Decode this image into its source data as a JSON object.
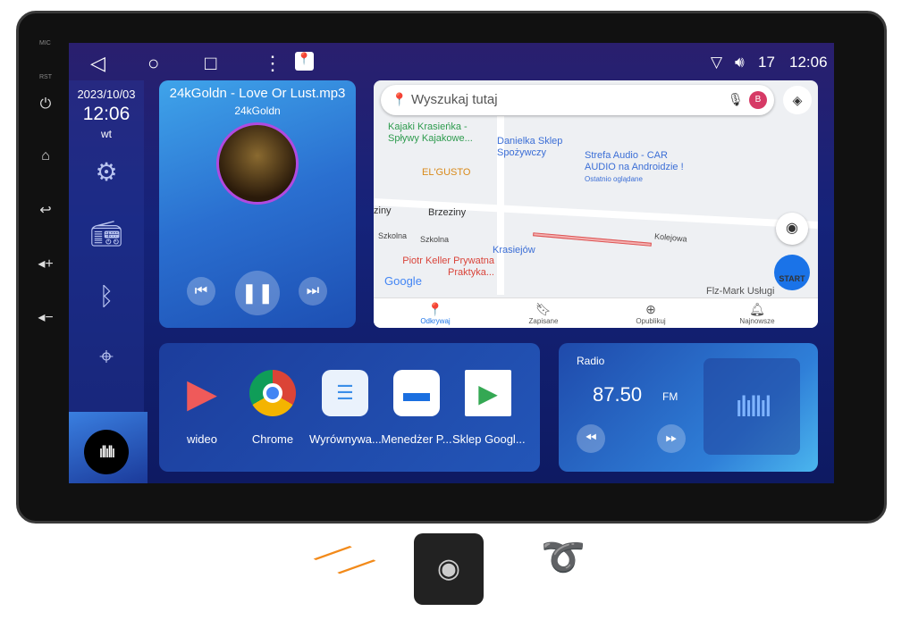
{
  "bezel": {
    "labels": [
      "MIC",
      "RST"
    ],
    "buttons": [
      "power-icon",
      "home-icon",
      "back-icon",
      "volume-up-icon",
      "volume-down-icon"
    ]
  },
  "nav": {
    "icons": [
      "back-icon",
      "home-icon",
      "recents-icon",
      "more-icon",
      "maps-icon"
    ]
  },
  "status": {
    "volume": "17",
    "time": "12:06"
  },
  "clock": {
    "date": "2023/10/03",
    "time": "12:06",
    "day": "wt"
  },
  "sidebar": {
    "icons": [
      "settings-icon",
      "radio-icon",
      "bluetooth-icon",
      "location-icon",
      "voice-icon"
    ]
  },
  "music": {
    "title": "24kGoldn - Love Or Lust.mp3",
    "artist": "24kGoldn"
  },
  "map": {
    "search_placeholder": "Wyszukaj tutaj",
    "avatar": "B",
    "pois": {
      "kajaki": "Kajaki Krasieńka - Spływy Kajakowe...",
      "danielka": "Danielka Sklep Spożywczy",
      "strefa": "Strefa Audio - CAR AUDIO na Androidzie !",
      "strefa_sub": "Ostatnio oglądane",
      "elgusto": "EL'GUSTO",
      "brzeziny": "Brzeziny",
      "brzeziny2": "ziny",
      "szkolna1": "Szkolna",
      "szkolna2": "Szkolna",
      "kolejowa": "Kolejowa",
      "krasiejow": "Krasiejów",
      "keller": "Piotr Keller Prywatna Praktyka...",
      "flz": "Flz-Mark Usługi Glazurnicze",
      "google": "Google",
      "start": "START"
    },
    "tabs": [
      {
        "label": "Odkrywaj"
      },
      {
        "label": "Zapisane"
      },
      {
        "label": "Opublikuj"
      },
      {
        "label": "Najnowsze"
      }
    ]
  },
  "apps": [
    {
      "label": "wideo"
    },
    {
      "label": "Chrome"
    },
    {
      "label": "Wyrównywa..."
    },
    {
      "label": "Menedżer P..."
    },
    {
      "label": "Sklep Googl..."
    }
  ],
  "radio": {
    "title": "Radio",
    "frequency": "87.50",
    "band": "FM"
  },
  "colors": {
    "accent": "#3fa4ea",
    "screen_bg": "#15237a",
    "map_accent": "#1a73e8"
  }
}
